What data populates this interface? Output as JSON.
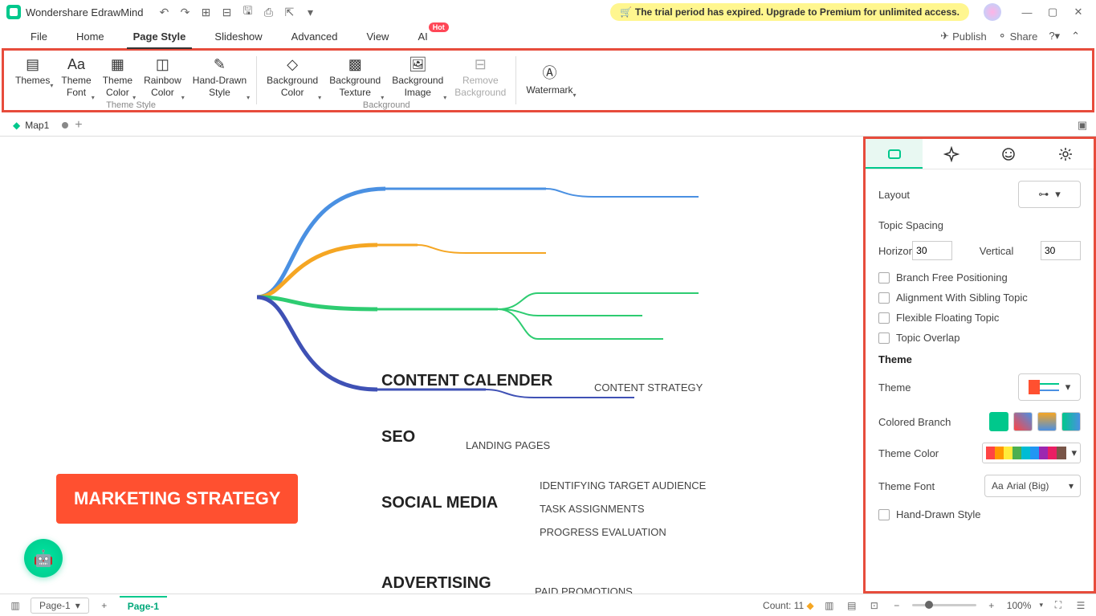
{
  "app": {
    "name": "Wondershare EdrawMind",
    "trial_message": "The trial period has expired. Upgrade to Premium for unlimited access."
  },
  "menu": {
    "items": [
      "File",
      "Home",
      "Page Style",
      "Slideshow",
      "Advanced",
      "View",
      "AI"
    ],
    "active": "Page Style",
    "hot": "Hot",
    "publish": "Publish",
    "share": "Share"
  },
  "ribbon": {
    "theme_style_label": "Theme Style",
    "background_label": "Background",
    "buttons": {
      "themes": "Themes",
      "theme_font": "Theme\nFont",
      "theme_color": "Theme\nColor",
      "rainbow_color": "Rainbow\nColor",
      "hand_drawn": "Hand-Drawn\nStyle",
      "bg_color": "Background\nColor",
      "bg_texture": "Background\nTexture",
      "bg_image": "Background\nImage",
      "remove_bg": "Remove\nBackground",
      "watermark": "Watermark"
    }
  },
  "doc_tab": {
    "name": "Map1"
  },
  "mindmap": {
    "central": "MARKETING STRATEGY",
    "branches": [
      {
        "label": "CONTENT CALENDER",
        "subs": [
          "CONTENT STRATEGY"
        ]
      },
      {
        "label": "SEO",
        "subs": [
          "LANDING PAGES"
        ]
      },
      {
        "label": "SOCIAL MEDIA",
        "subs": [
          "IDENTIFYING TARGET AUDIENCE",
          "TASK ASSIGNMENTS",
          "PROGRESS EVALUATION"
        ]
      },
      {
        "label": "ADVERTISING",
        "subs": [
          "PAID PROMOTIONS"
        ]
      }
    ]
  },
  "side": {
    "layout_label": "Layout",
    "topic_spacing": "Topic Spacing",
    "horizontal": "Horizontal",
    "horizontal_val": "30",
    "vertical": "Vertical",
    "vertical_val": "30",
    "branch_free": "Branch Free Positioning",
    "align_sibling": "Alignment With Sibling Topic",
    "flex_float": "Flexible Floating Topic",
    "overlap": "Topic Overlap",
    "theme_section": "Theme",
    "theme_label": "Theme",
    "colored_branch": "Colored Branch",
    "theme_color": "Theme Color",
    "theme_font": "Theme Font",
    "theme_font_val": "Arial (Big)",
    "hand_drawn": "Hand-Drawn Style"
  },
  "status": {
    "page_selector": "Page-1",
    "page_tab": "Page-1",
    "count": "Count: 11",
    "zoom": "100%"
  }
}
